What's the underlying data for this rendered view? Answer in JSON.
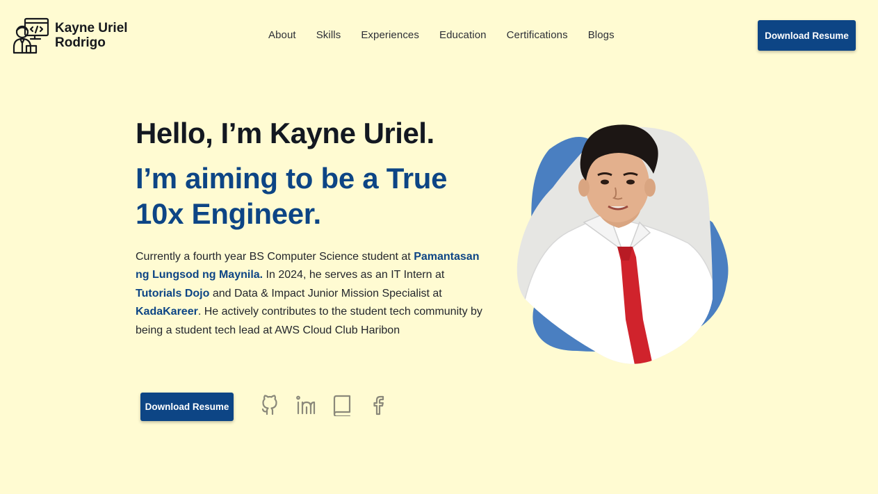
{
  "header": {
    "brand_name": "Kayne Uriel Rodrigo",
    "brand_logo_icon": "developer-avatar-icon",
    "nav": [
      {
        "label": "About"
      },
      {
        "label": "Skills"
      },
      {
        "label": "Experiences"
      },
      {
        "label": "Education"
      },
      {
        "label": "Certifications"
      },
      {
        "label": "Blogs"
      }
    ],
    "download_label": "Download Resume"
  },
  "hero": {
    "greeting": "Hello, I’m Kayne Uriel.",
    "aim": "I’m aiming to be a True 10x Engineer.",
    "desc": {
      "p1": "Currently a fourth year BS Computer Science student at ",
      "school": "Pamantasan ng Lungsod ng Maynila.",
      "p2": " In 2024, he serves as an IT Intern at ",
      "company1": "Tutorials Dojo",
      "p3": " and Data & Impact Junior Mission Specialist at ",
      "company2": "KadaKareer",
      "p4": ". He actively contributes to the student tech community by being a student tech lead at AWS Cloud Club Haribon"
    },
    "download_label": "Download Resume",
    "socials": [
      {
        "icon": "github-icon"
      },
      {
        "icon": "linkedin-icon"
      },
      {
        "icon": "book-icon"
      },
      {
        "icon": "facebook-icon"
      }
    ]
  },
  "colors": {
    "background": "#fffbd2",
    "accent": "#0d4585",
    "blob": "#4a7fc1",
    "shirt": "#ffffff",
    "tie": "#d0232c",
    "icon": "#8a887a"
  }
}
